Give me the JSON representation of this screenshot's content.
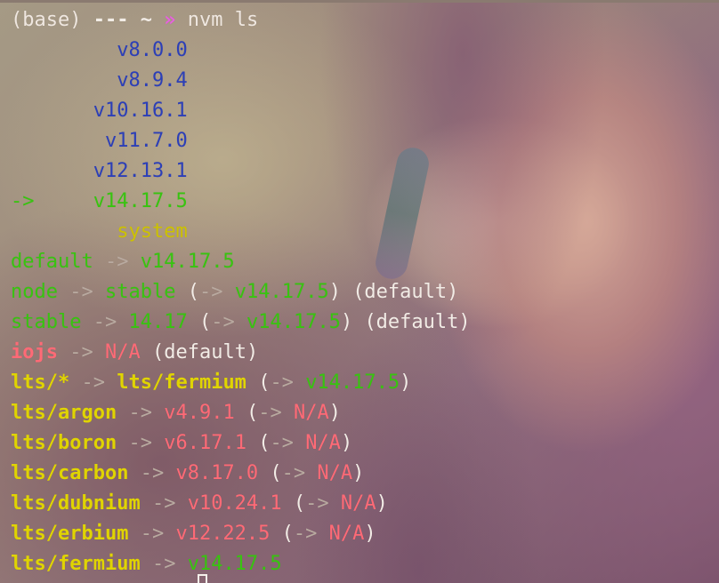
{
  "prompt": {
    "env": "(base)",
    "dashes": "---",
    "dir": "~",
    "chevron": "»",
    "command": "nvm ls"
  },
  "installed": [
    {
      "marker": "",
      "version": "v8.0.0",
      "color": "#2c3fb8"
    },
    {
      "marker": "",
      "version": "v8.9.4",
      "color": "#2c3fb8"
    },
    {
      "marker": "",
      "version": "v10.16.1",
      "color": "#2c3fb8"
    },
    {
      "marker": "",
      "version": "v11.7.0",
      "color": "#2c3fb8"
    },
    {
      "marker": "",
      "version": "v12.13.1",
      "color": "#2c3fb8"
    },
    {
      "marker": "->",
      "version": "v14.17.5",
      "color": "#38c410"
    },
    {
      "marker": "",
      "version": "system",
      "color": "#cdc200"
    }
  ],
  "aliases": {
    "default": {
      "name": "default",
      "arrow": "->",
      "target": "v14.17.5"
    },
    "node": {
      "name": "node",
      "arrow": "->",
      "target": "stable",
      "open": "(",
      "inner_arrow": "->",
      "resolved": "v14.17.5",
      "close": ")",
      "suffix": "(default)"
    },
    "stable": {
      "name": "stable",
      "arrow": "->",
      "target": "14.17",
      "open": "(",
      "inner_arrow": "->",
      "resolved": "v14.17.5",
      "close": ")",
      "suffix": "(default)"
    },
    "iojs": {
      "name": "iojs",
      "arrow": "->",
      "target": "N/A",
      "suffix": "(default)"
    }
  },
  "lts": [
    {
      "name": "lts/*",
      "arrow": "->",
      "target": "lts/fermium",
      "open": "(",
      "inner_arrow": "->",
      "resolved": "v14.17.5",
      "close": ")"
    },
    {
      "name": "lts/argon",
      "arrow": "->",
      "target": "v4.9.1",
      "open": "(",
      "inner_arrow": "->",
      "resolved": "N/A",
      "close": ")"
    },
    {
      "name": "lts/boron",
      "arrow": "->",
      "target": "v6.17.1",
      "open": "(",
      "inner_arrow": "->",
      "resolved": "N/A",
      "close": ")"
    },
    {
      "name": "lts/carbon",
      "arrow": "->",
      "target": "v8.17.0",
      "open": "(",
      "inner_arrow": "->",
      "resolved": "N/A",
      "close": ")"
    },
    {
      "name": "lts/dubnium",
      "arrow": "->",
      "target": "v10.24.1",
      "open": "(",
      "inner_arrow": "->",
      "resolved": "N/A",
      "close": ")"
    },
    {
      "name": "lts/erbium",
      "arrow": "->",
      "target": "v12.22.5",
      "open": "(",
      "inner_arrow": "->",
      "resolved": "N/A",
      "close": ")"
    },
    {
      "name": "lts/fermium",
      "arrow": "->",
      "target": "v14.17.5"
    }
  ],
  "colors": {
    "installed_version": "#2c3fb8",
    "current_version": "#38c410",
    "system": "#cdc200",
    "not_available": "#ff6a76",
    "lts_name": "#e0d400"
  }
}
